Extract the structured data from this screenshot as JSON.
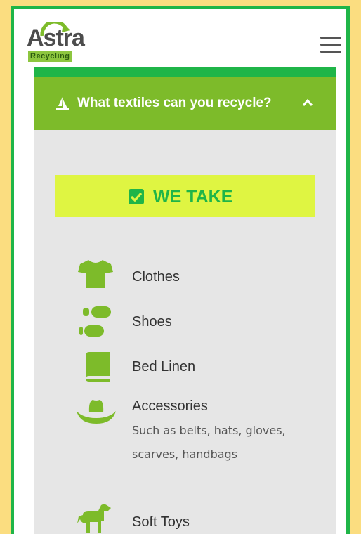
{
  "header": {
    "logo_word": "Astra",
    "logo_sub": "Recycling",
    "menu_icon": "hamburger-menu-icon"
  },
  "accordion": {
    "icon": "recycle-triangle-icon",
    "title": "What textiles can you recycle?",
    "chevron_icon": "chevron-up-icon"
  },
  "we_take": {
    "icon": "checkbox-checked-icon",
    "label": "WE TAKE"
  },
  "items": [
    {
      "icon": "tshirt-icon",
      "label": "Clothes"
    },
    {
      "icon": "footprints-icon",
      "label": "Shoes"
    },
    {
      "icon": "book-icon",
      "label": "Bed Linen"
    },
    {
      "icon": "hat-icon",
      "label": "Accessories",
      "description": "Such as belts, hats, gloves, scarves, handbags"
    },
    {
      "icon": "horse-icon",
      "label": "Soft Toys"
    }
  ],
  "colors": {
    "page_background": "#fbdd80",
    "frame": "#1fb548",
    "accent_green": "#7dbb2a",
    "we_take_bg": "#dff542",
    "panel_bg": "#e6e6e6"
  }
}
